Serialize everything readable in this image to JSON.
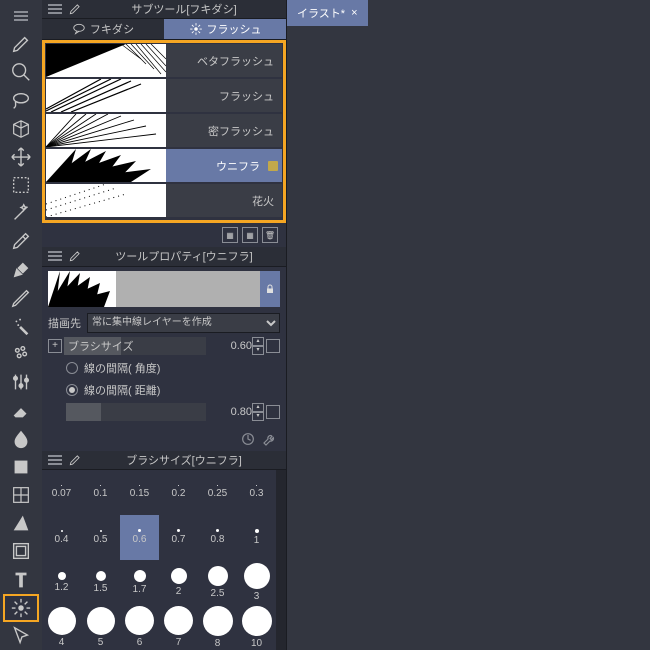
{
  "toolbar": {
    "tools": [
      "menu",
      "brush",
      "magnify",
      "lasso",
      "cube",
      "move",
      "marquee",
      "wand",
      "eyedropper",
      "pen",
      "pencil",
      "airbrush",
      "marker",
      "adjust",
      "eraser",
      "blend",
      "fill",
      "grid",
      "shape",
      "frame",
      "text",
      "flash",
      "pointer"
    ]
  },
  "subtool": {
    "title": "サブツール[フキダシ]",
    "tabs": [
      {
        "label": "フキダシ",
        "active": false
      },
      {
        "label": "フラッシュ",
        "active": true
      }
    ],
    "items": [
      {
        "label": "ベタフラッシュ"
      },
      {
        "label": "フラッシュ"
      },
      {
        "label": "密フラッシュ"
      },
      {
        "label": "ウニフラ",
        "selected": true,
        "locked": true
      },
      {
        "label": "花火"
      }
    ]
  },
  "property": {
    "title": "ツールプロパティ[ウニフラ]",
    "draw_dest_label": "描画先",
    "draw_dest_value": "常に集中線レイヤーを作成",
    "brush_size_label": "ブラシサイズ",
    "brush_size_value": "0.60",
    "interval_angle_label": "線の間隔( 角度)",
    "interval_dist_label": "線の間隔( 距離)",
    "interval_dist_value": "0.80"
  },
  "sizes": {
    "title": "ブラシサイズ[ウニフラ]",
    "grid": [
      {
        "v": "0.07",
        "d": 1
      },
      {
        "v": "0.1",
        "d": 1
      },
      {
        "v": "0.15",
        "d": 1
      },
      {
        "v": "0.2",
        "d": 1
      },
      {
        "v": "0.25",
        "d": 1
      },
      {
        "v": "0.3",
        "d": 1
      },
      {
        "v": "0.4",
        "d": 2
      },
      {
        "v": "0.5",
        "d": 2
      },
      {
        "v": "0.6",
        "d": 3,
        "sel": true
      },
      {
        "v": "0.7",
        "d": 3
      },
      {
        "v": "0.8",
        "d": 3
      },
      {
        "v": "1",
        "d": 4
      },
      {
        "v": "1.2",
        "d": 8
      },
      {
        "v": "1.5",
        "d": 10
      },
      {
        "v": "1.7",
        "d": 12
      },
      {
        "v": "2",
        "d": 16
      },
      {
        "v": "2.5",
        "d": 20
      },
      {
        "v": "3",
        "d": 26
      },
      {
        "v": "4",
        "d": 28
      },
      {
        "v": "5",
        "d": 28
      },
      {
        "v": "6",
        "d": 29
      },
      {
        "v": "7",
        "d": 29
      },
      {
        "v": "8",
        "d": 30
      },
      {
        "v": "10",
        "d": 30
      }
    ]
  },
  "canvas": {
    "tab": "イラスト*"
  }
}
